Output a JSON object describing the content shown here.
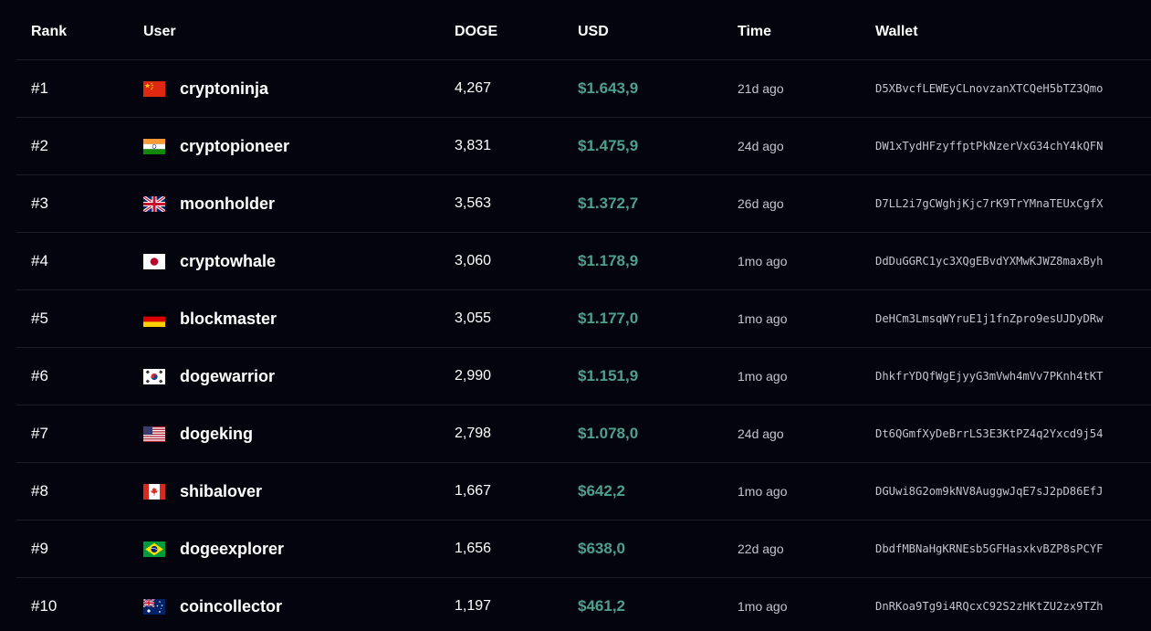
{
  "headers": {
    "rank": "Rank",
    "user": "User",
    "doge": "DOGE",
    "usd": "USD",
    "time": "Time",
    "wallet": "Wallet"
  },
  "colors": {
    "background": "#04040f",
    "usd_accent": "#4fa08b",
    "divider": "#1b1e2a"
  },
  "rows": [
    {
      "rank": "#1",
      "flag": "china-flag-icon",
      "user": "cryptoninja",
      "doge": "4,267",
      "usd": "$1.643,9",
      "time": "21d ago",
      "wallet": "D5XBvcfLEWEyCLnovzanXTCQeH5bTZ3Qmo"
    },
    {
      "rank": "#2",
      "flag": "india-flag-icon",
      "user": "cryptopioneer",
      "doge": "3,831",
      "usd": "$1.475,9",
      "time": "24d ago",
      "wallet": "DW1xTydHFzyffptPkNzerVxG34chY4kQFN"
    },
    {
      "rank": "#3",
      "flag": "uk-flag-icon",
      "user": "moonholder",
      "doge": "3,563",
      "usd": "$1.372,7",
      "time": "26d ago",
      "wallet": "D7LL2i7gCWghjKjc7rK9TrYMnaTEUxCgfX"
    },
    {
      "rank": "#4",
      "flag": "japan-flag-icon",
      "user": "cryptowhale",
      "doge": "3,060",
      "usd": "$1.178,9",
      "time": "1mo ago",
      "wallet": "DdDuGGRC1yc3XQgEBvdYXMwKJWZ8maxByh"
    },
    {
      "rank": "#5",
      "flag": "germany-flag-icon",
      "user": "blockmaster",
      "doge": "3,055",
      "usd": "$1.177,0",
      "time": "1mo ago",
      "wallet": "DeHCm3LmsqWYruE1j1fnZpro9esUJDyDRw"
    },
    {
      "rank": "#6",
      "flag": "south-korea-flag-icon",
      "user": "dogewarrior",
      "doge": "2,990",
      "usd": "$1.151,9",
      "time": "1mo ago",
      "wallet": "DhkfrYDQfWgEjyyG3mVwh4mVv7PKnh4tKT"
    },
    {
      "rank": "#7",
      "flag": "usa-flag-icon",
      "user": "dogeking",
      "doge": "2,798",
      "usd": "$1.078,0",
      "time": "24d ago",
      "wallet": "Dt6QGmfXyDeBrrLS3E3KtPZ4q2Yxcd9j54"
    },
    {
      "rank": "#8",
      "flag": "canada-flag-icon",
      "user": "shibalover",
      "doge": "1,667",
      "usd": "$642,2",
      "time": "1mo ago",
      "wallet": "DGUwi8G2om9kNV8AuggwJqE7sJ2pD86EfJ"
    },
    {
      "rank": "#9",
      "flag": "brazil-flag-icon",
      "user": "dogeexplorer",
      "doge": "1,656",
      "usd": "$638,0",
      "time": "22d ago",
      "wallet": "DbdfMBNaHgKRNEsb5GFHasxkvBZP8sPCYF"
    },
    {
      "rank": "#10",
      "flag": "australia-flag-icon",
      "user": "coincollector",
      "doge": "1,197",
      "usd": "$461,2",
      "time": "1mo ago",
      "wallet": "DnRKoa9Tg9i4RQcxC92S2zHKtZU2zx9TZh"
    }
  ]
}
